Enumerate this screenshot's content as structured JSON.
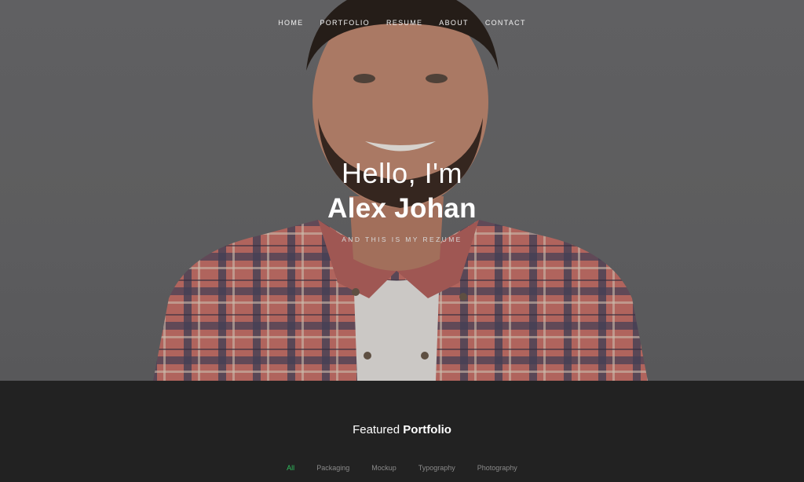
{
  "nav": {
    "items": [
      {
        "label": "HOME"
      },
      {
        "label": "PORTFOLIO"
      },
      {
        "label": "RESUME"
      },
      {
        "label": "ABOUT"
      },
      {
        "label": "CONTACT"
      }
    ]
  },
  "hero": {
    "greeting": "Hello, I'm",
    "name": "Alex Johan",
    "tagline": "AND THIS IS MY REZUME",
    "photo_icon": "portrait-photo"
  },
  "portfolio": {
    "title_light": "Featured",
    "title_bold": "Portfolio",
    "filters": [
      {
        "label": "All",
        "active": true
      },
      {
        "label": "Packaging",
        "active": false
      },
      {
        "label": "Mockup",
        "active": false
      },
      {
        "label": "Typography",
        "active": false
      },
      {
        "label": "Photography",
        "active": false
      }
    ]
  },
  "colors": {
    "accent": "#2fbf5e",
    "dark_bg": "#222222"
  }
}
